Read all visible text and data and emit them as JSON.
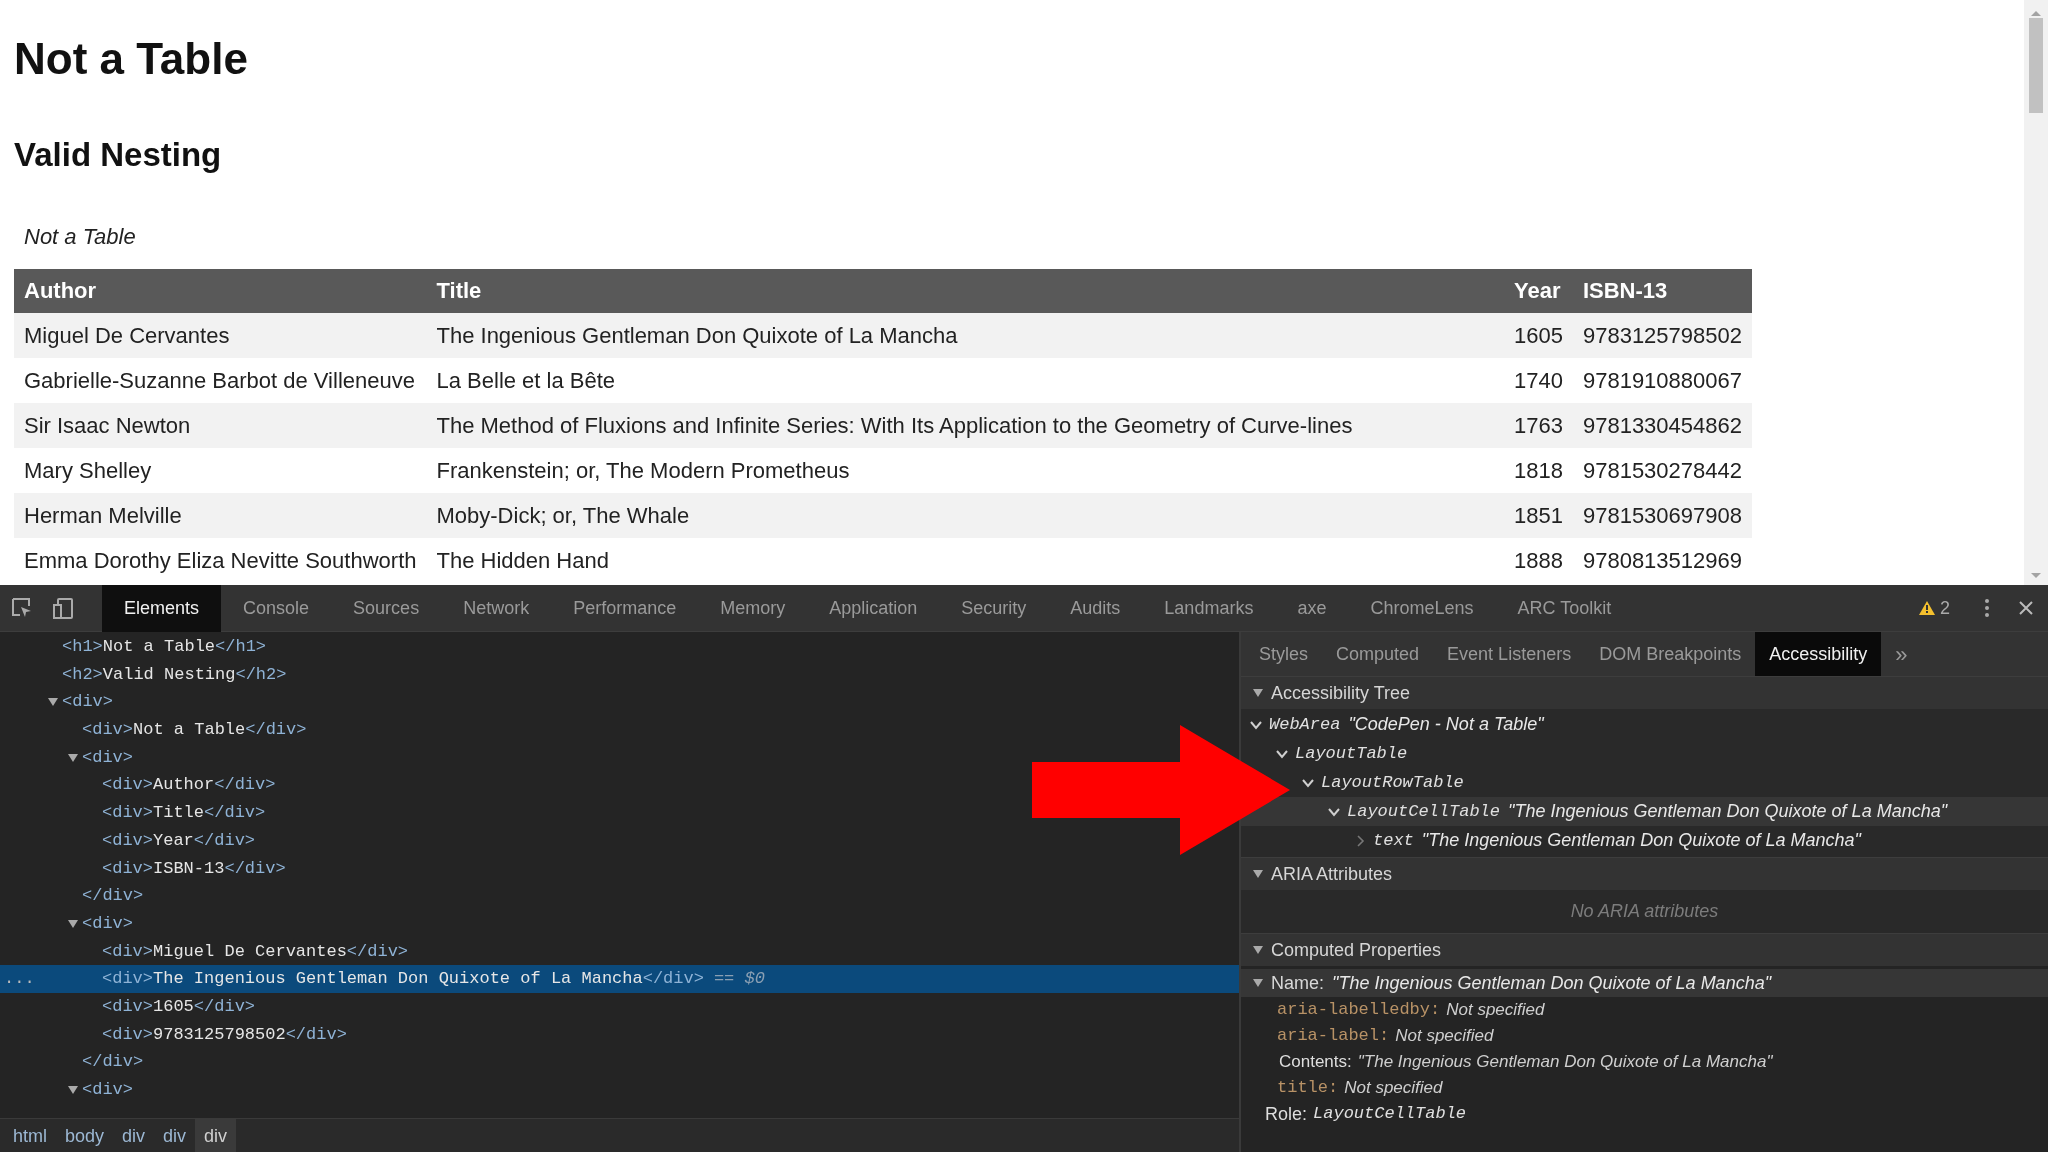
{
  "page": {
    "heading": "Not a Table",
    "subheading": "Valid Nesting",
    "caption": "Not a Table",
    "columns": [
      "Author",
      "Title",
      "Year",
      "ISBN-13"
    ],
    "rows": [
      [
        "Miguel De Cervantes",
        "The Ingenious Gentleman Don Quixote of La Mancha",
        "1605",
        "9783125798502"
      ],
      [
        "Gabrielle-Suzanne Barbot de Villeneuve",
        "La Belle et la Bête",
        "1740",
        "9781910880067"
      ],
      [
        "Sir Isaac Newton",
        "The Method of Fluxions and Infinite Series: With Its Application to the Geometry of Curve-lines",
        "1763",
        "9781330454862"
      ],
      [
        "Mary Shelley",
        "Frankenstein; or, The Modern Prometheus",
        "1818",
        "9781530278442"
      ],
      [
        "Herman Melville",
        "Moby-Dick; or, The Whale",
        "1851",
        "9781530697908"
      ],
      [
        "Emma Dorothy Eliza Nevitte Southworth",
        "The Hidden Hand",
        "1888",
        "9780813512969"
      ]
    ]
  },
  "devtools": {
    "tabs": [
      {
        "label": "Elements",
        "selected": true
      },
      {
        "label": "Console",
        "selected": false
      },
      {
        "label": "Sources",
        "selected": false
      },
      {
        "label": "Network",
        "selected": false
      },
      {
        "label": "Performance",
        "selected": false
      },
      {
        "label": "Memory",
        "selected": false
      },
      {
        "label": "Application",
        "selected": false
      },
      {
        "label": "Security",
        "selected": false
      },
      {
        "label": "Audits",
        "selected": false
      },
      {
        "label": "Landmarks",
        "selected": false
      },
      {
        "label": "axe",
        "selected": false
      },
      {
        "label": "ChromeLens",
        "selected": false
      },
      {
        "label": "ARC Toolkit",
        "selected": false
      }
    ],
    "warnings": "2",
    "dom_tree": [
      {
        "open": "<h1>",
        "text": "Not a Table",
        "close": "</h1>",
        "selected": false
      },
      {
        "open": "<h2>",
        "text": "Valid Nesting",
        "close": "</h2>",
        "selected": false
      },
      {
        "open": "<div>",
        "expanded": true,
        "selected": false,
        "children": [
          {
            "open": "<div>",
            "text": "Not a Table",
            "close": "</div>",
            "selected": false
          },
          {
            "open": "<div>",
            "expanded": true,
            "selected": false,
            "end": "</div>",
            "children": [
              {
                "open": "<div>",
                "text": "Author",
                "close": "</div>",
                "selected": false
              },
              {
                "open": "<div>",
                "text": "Title",
                "close": "</div>",
                "selected": false
              },
              {
                "open": "<div>",
                "text": "Year",
                "close": "</div>",
                "selected": false
              },
              {
                "open": "<div>",
                "text": "ISBN-13",
                "close": "</div>",
                "selected": false
              }
            ]
          },
          {
            "open": "<div>",
            "expanded": true,
            "selected": false,
            "end": "</div>",
            "children": [
              {
                "open": "<div>",
                "text": "Miguel De Cervantes",
                "close": "</div>",
                "selected": false
              },
              {
                "open": "<div>",
                "text": "The Ingenious Gentleman Don Quixote of La Mancha",
                "close": "</div>",
                "selected": true,
                "gutter": "...",
                "suffix": "== $0"
              },
              {
                "open": "<div>",
                "text": "1605",
                "close": "</div>",
                "selected": false
              },
              {
                "open": "<div>",
                "text": "9783125798502",
                "close": "</div>",
                "selected": false
              }
            ]
          },
          {
            "open": "<div>",
            "expanded": true,
            "selected": false
          }
        ]
      }
    ],
    "breadcrumbs": [
      {
        "label": "html",
        "selected": false
      },
      {
        "label": "body",
        "selected": false
      },
      {
        "label": "div",
        "selected": false
      },
      {
        "label": "div",
        "selected": false
      },
      {
        "label": "div",
        "selected": true
      }
    ],
    "sidebar_tabs": [
      {
        "label": "Styles",
        "selected": false
      },
      {
        "label": "Computed",
        "selected": false
      },
      {
        "label": "Event Listeners",
        "selected": false
      },
      {
        "label": "DOM Breakpoints",
        "selected": false
      },
      {
        "label": "Accessibility",
        "selected": true
      }
    ],
    "sidebar_overflow": "»",
    "accessibility_tree": {
      "title": "Accessibility Tree",
      "expanded": true,
      "nodes": [
        {
          "role": "WebArea",
          "name": "\"CodePen - Not a Table\"",
          "expanded": true,
          "selected": false,
          "children": [
            {
              "role": "LayoutTable",
              "expanded": true,
              "selected": false,
              "children": [
                {
                  "role": "LayoutRowTable",
                  "expanded": true,
                  "selected": false,
                  "children": [
                    {
                      "role": "LayoutCellTable",
                      "name": "\"The Ingenious Gentleman Don Quixote of La Mancha\"",
                      "expanded": true,
                      "selected": true,
                      "children": [
                        {
                          "role": "text",
                          "name": "\"The Ingenious Gentleman Don Quixote of La Mancha\"",
                          "expanded": false,
                          "selected": false
                        }
                      ]
                    }
                  ]
                }
              ]
            }
          ]
        }
      ]
    },
    "aria_attributes": {
      "title": "ARIA Attributes",
      "expanded": true,
      "empty_text": "No ARIA attributes"
    },
    "computed_properties": {
      "title": "Computed Properties",
      "expanded": true,
      "name": {
        "label": "Name:",
        "value": "\"The Ingenious Gentleman Don Quixote of La Mancha\"",
        "expanded": true
      },
      "sources": [
        {
          "kind": "attribute",
          "key": "aria-labelledby:",
          "value": "Not specified"
        },
        {
          "kind": "attribute",
          "key": "aria-label:",
          "value": "Not specified"
        },
        {
          "kind": "content",
          "key": "Contents:",
          "value": "\"The Ingenious Gentleman Don Quixote of La Mancha\""
        },
        {
          "kind": "attribute",
          "key": "title:",
          "value": "Not specified"
        }
      ],
      "role": {
        "label": "Role:",
        "value": "LayoutCellTable"
      }
    }
  }
}
